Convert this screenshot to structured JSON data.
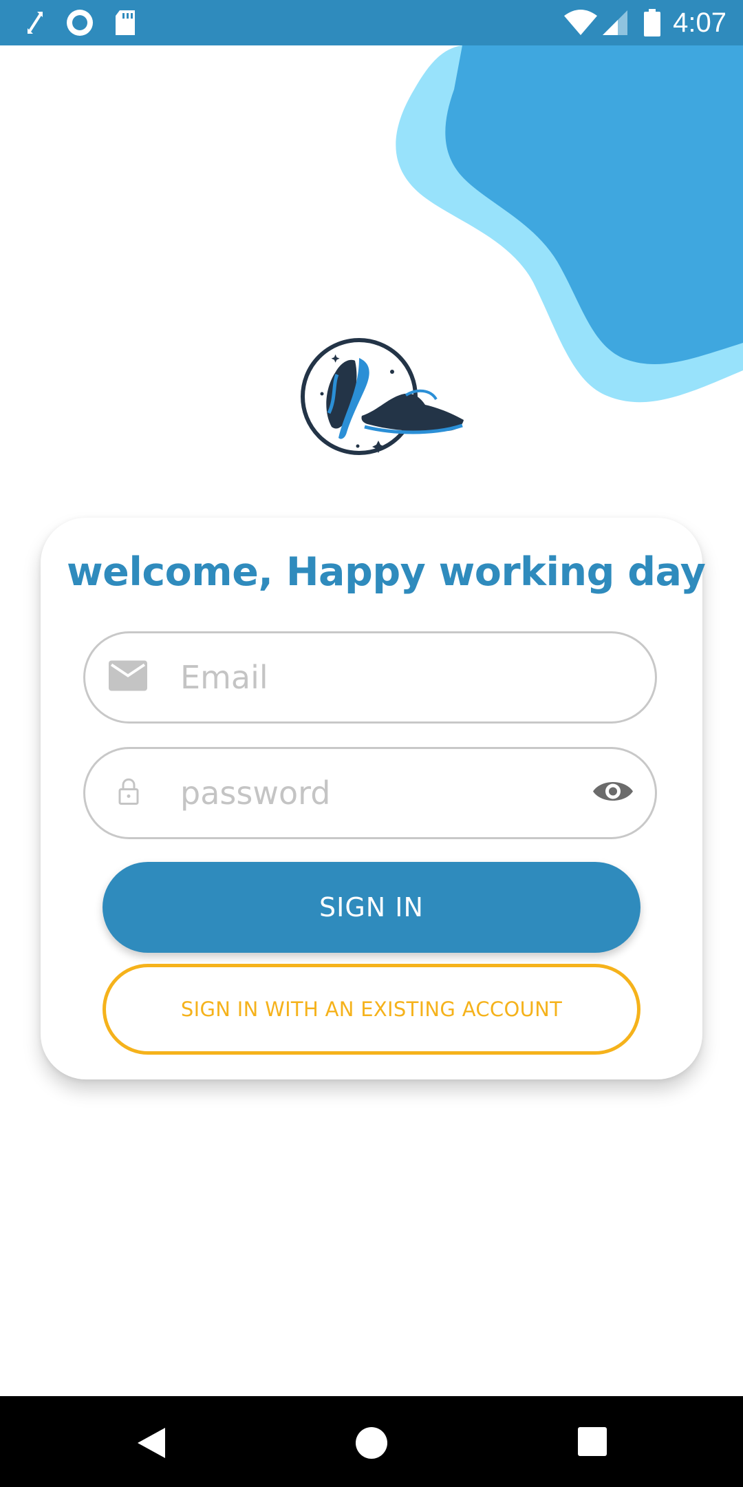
{
  "status_bar": {
    "time": "4:07",
    "icons": [
      "fullscreen-arrows-icon",
      "sync-circle-icon",
      "sd-card-icon",
      "wifi-icon",
      "cell-signal-icon",
      "battery-icon"
    ]
  },
  "login": {
    "welcome": "welcome, Happy working day",
    "email_placeholder": "Email",
    "password_placeholder": "password",
    "sign_in": "SIGN IN",
    "sign_in_existing": "SIGN IN WITH AN EXISTING ACCOUNT"
  },
  "nav": {
    "back": "back-icon",
    "home": "home-icon",
    "recents": "recents-icon"
  },
  "colors": {
    "primary": "#2f8bbd",
    "accent": "#f5b21b",
    "blob_dark": "#3fa7df",
    "blob_light": "#98e2fb",
    "logo_navy": "#233447"
  }
}
